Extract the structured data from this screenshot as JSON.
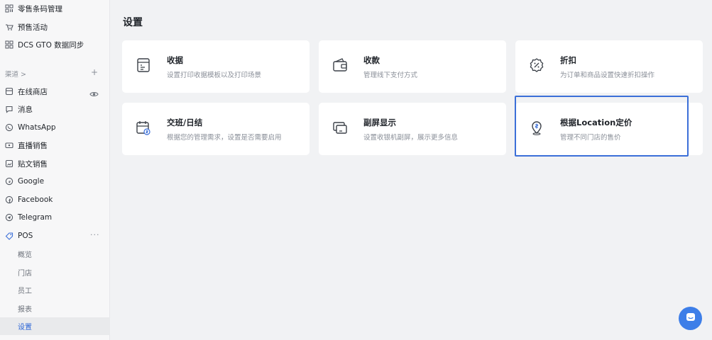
{
  "sidebar": {
    "top_items": [
      {
        "label": "零售条码管理",
        "icon": "barcode-icon"
      },
      {
        "label": "预售活动",
        "icon": "presale-icon"
      },
      {
        "label": "DCS GTO 数据同步",
        "icon": "sync-icon"
      }
    ],
    "section": {
      "label": "渠道 >",
      "plus": "+"
    },
    "channels": [
      {
        "label": "在线商店",
        "icon": "store-icon"
      },
      {
        "label": "消息",
        "icon": "message-icon"
      },
      {
        "label": "WhatsApp",
        "icon": "whatsapp-icon"
      },
      {
        "label": "直播销售",
        "icon": "live-icon"
      },
      {
        "label": "贴文销售",
        "icon": "post-icon"
      },
      {
        "label": "Google",
        "icon": "google-icon"
      },
      {
        "label": "Facebook",
        "icon": "facebook-icon"
      },
      {
        "label": "Telegram",
        "icon": "telegram-icon"
      },
      {
        "label": "POS",
        "icon": "pos-icon"
      }
    ],
    "more": "···",
    "pos_sub": [
      {
        "label": "概览"
      },
      {
        "label": "门店"
      },
      {
        "label": "员工"
      },
      {
        "label": "报表"
      },
      {
        "label": "设置"
      }
    ],
    "active": "设置"
  },
  "main": {
    "title": "设置",
    "cards": [
      {
        "title": "收据",
        "desc": "设置打印收据模板以及打印场景",
        "icon": "receipt-icon"
      },
      {
        "title": "收款",
        "desc": "管理线下支付方式",
        "icon": "wallet-icon"
      },
      {
        "title": "折扣",
        "desc": "为订单和商品设置快速折扣操作",
        "icon": "discount-icon"
      },
      {
        "title": "交班/日结",
        "desc": "根据您的管理需求，设置是否需要启用",
        "icon": "calendar-money-icon"
      },
      {
        "title": "副屏显示",
        "desc": "设置收银机副屏，展示更多信息",
        "icon": "second-screen-icon"
      },
      {
        "title": "根据Location定价",
        "desc": "管理不同门店的售价",
        "icon": "location-price-icon"
      }
    ]
  },
  "colors": {
    "accent": "#3b6fd8",
    "chat": "#3d7ee8",
    "background": "#f1f2f4",
    "card": "#ffffff"
  }
}
